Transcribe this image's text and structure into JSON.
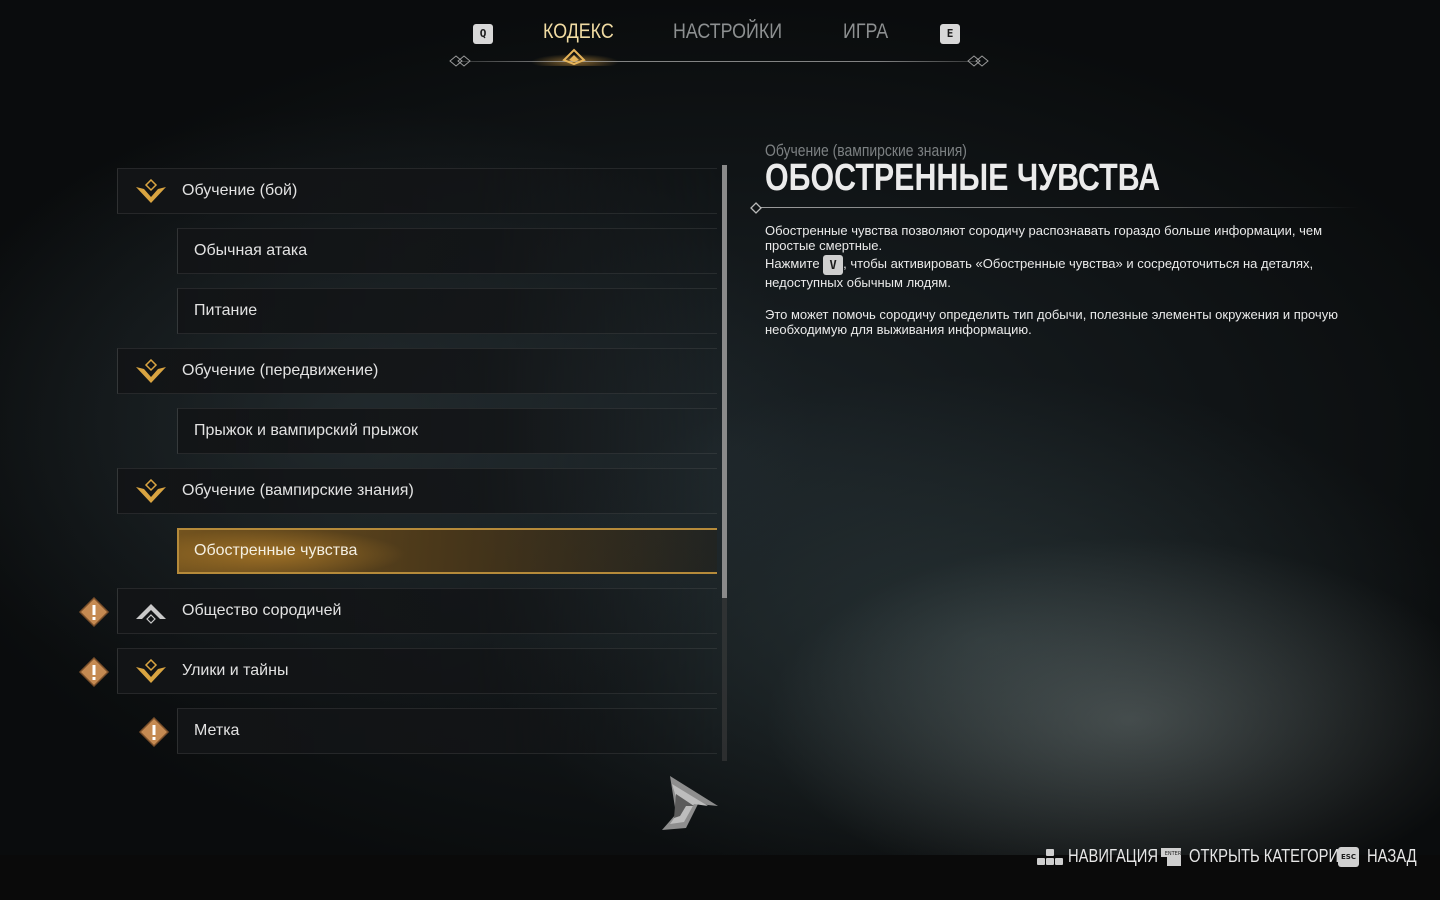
{
  "tabs": {
    "prev_key": "Q",
    "next_key": "E",
    "items": [
      {
        "label": "КОДЕКС",
        "active": true
      },
      {
        "label": "НАСТРОЙКИ",
        "active": false
      },
      {
        "label": "ИГРА",
        "active": false
      }
    ]
  },
  "codex_list": [
    {
      "label": "Обучение (бой)",
      "type": "category",
      "icon": "wings-emblem-icon"
    },
    {
      "label": "Обычная атака",
      "type": "entry"
    },
    {
      "label": "Питание",
      "type": "entry"
    },
    {
      "label": "Обучение (передвижение)",
      "type": "category",
      "icon": "wings-emblem-icon"
    },
    {
      "label": "Прыжок и вампирский прыжок",
      "type": "entry"
    },
    {
      "label": "Обучение (вампирские знания)",
      "type": "category",
      "icon": "wings-emblem-icon"
    },
    {
      "label": "Обостренные чувства",
      "type": "entry",
      "selected": true
    },
    {
      "label": "Общество сородичей",
      "type": "category",
      "icon": "peak-emblem-icon",
      "new": true
    },
    {
      "label": "Улики и тайны",
      "type": "category",
      "icon": "wings-emblem-icon",
      "new": true
    },
    {
      "label": "Метка",
      "type": "entry",
      "new": true
    }
  ],
  "detail": {
    "category": "Обучение (вампирские знания)",
    "title": "ОБОСТРЕННЫЕ ЧУВСТВА",
    "para1": "Обостренные чувства позволяют сородичу распознавать гораздо больше информации, чем простые смертные.",
    "para2_before": "Нажмите ",
    "para2_key": "V",
    "para2_after": ", чтобы активировать «Обостренные чувства» и сосредоточиться на деталях, недоступных обычным людям.",
    "para3": "Это может помочь сородичу определить тип добычи, полезные элементы окружения и прочую необходимую для выживания информацию."
  },
  "footer": {
    "navigate": "НАВИГАЦИЯ",
    "open_category": "ОТКРЫТЬ КАТЕГОРИЮ",
    "enter_key": "ENTER",
    "back": "НАЗАД",
    "esc_key": "ESC"
  },
  "colors": {
    "accent_gold": "#d9a441",
    "active_tab": "#f1dca3",
    "inactive_tab": "#8d9091",
    "warning_badge": "#c58a52"
  }
}
